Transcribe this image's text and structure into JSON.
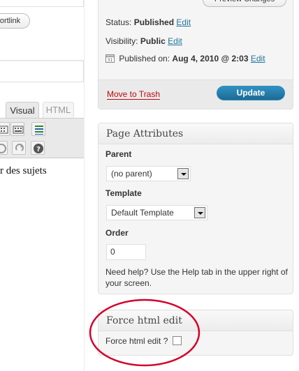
{
  "editor": {
    "shortlink_label": "ortlink",
    "tabs": [
      {
        "label": "Visual",
        "active": true
      },
      {
        "label": "HTML",
        "active": false
      }
    ],
    "toolbar_icons": [
      "fullscreen-icon",
      "kitchen-sink-icon",
      "justify-icon",
      "undo-icon",
      "redo-icon",
      "help-icon"
    ],
    "content_snippet": "r des sujets"
  },
  "publish": {
    "preview_label": "Preview Changes",
    "status_label": "Status:",
    "status_value": "Published",
    "status_edit": "Edit",
    "visibility_label": "Visibility:",
    "visibility_value": "Public",
    "visibility_edit": "Edit",
    "published_label": "Published on:",
    "published_value": "Aug 4, 2010 @ 2:03",
    "published_edit": "Edit",
    "trash_label": "Move to Trash",
    "update_label": "Update"
  },
  "page_attributes": {
    "title": "Page Attributes",
    "parent_label": "Parent",
    "parent_value": "(no parent)",
    "template_label": "Template",
    "template_value": "Default Template",
    "order_label": "Order",
    "order_value": "0",
    "help_text": "Need help? Use the Help tab in the upper right of your screen."
  },
  "force_html": {
    "title": "Force html edit",
    "checkbox_label": "Force html edit ?",
    "checked": false
  },
  "colors": {
    "link": "#21759b",
    "trash": "#bc0b0b",
    "update_button": "#2384b8",
    "highlight_ellipse": "#d4002a"
  }
}
